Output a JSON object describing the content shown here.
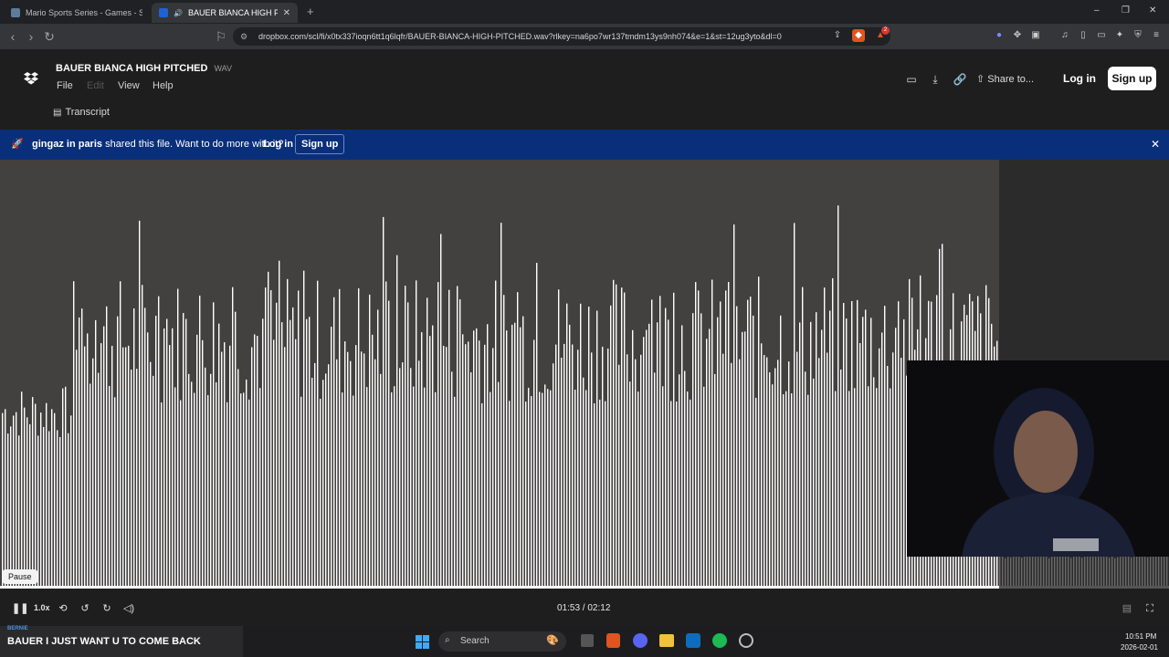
{
  "browser": {
    "tabs": [
      {
        "title": "Mario Sports Series - Games - Speed",
        "active": false
      },
      {
        "title": "BAUER BIANCA HIGH PITCHE",
        "active": true
      }
    ],
    "url": "dropbox.com/scl/fi/x0tx337ioqn6tt1q6lqfr/BAUER-BIANCA-HIGH-PITCHED.wav?rlkey=na6po7wr137tmdm13ys9nh074&e=1&st=12ug3yto&dl=0",
    "new_tab": "+",
    "window_controls": [
      "–",
      "❐",
      "✕"
    ],
    "shield_badge": "2"
  },
  "file": {
    "name": "BAUER BIANCA HIGH PITCHED",
    "ext": "WAV"
  },
  "menu": [
    "File",
    "Edit",
    "View",
    "Help"
  ],
  "transcript_label": "Transcript",
  "header": {
    "share_label": "Share to...",
    "login_label": "Log in",
    "signup_label": "Sign up"
  },
  "banner": {
    "user": "gingaz in paris",
    "message": " shared this file. Want to do more with it?",
    "login_label": "Log in",
    "signup_label": "Sign up"
  },
  "player": {
    "pause_tooltip": "Pause",
    "speed": "1.0x",
    "time": "01:53 / 02:12",
    "progress": 0.855
  },
  "overlay": {
    "caption": "BAUER I JUST WANT U TO COME BACK",
    "small_label": "BERNIE"
  },
  "taskbar": {
    "search_placeholder": "Search",
    "time": "10:51 PM",
    "date": "2026-02-01"
  },
  "colors": {
    "banner": "#0a2f7a",
    "wave_bg": "#434040",
    "wave_bar": "#ffffff"
  }
}
